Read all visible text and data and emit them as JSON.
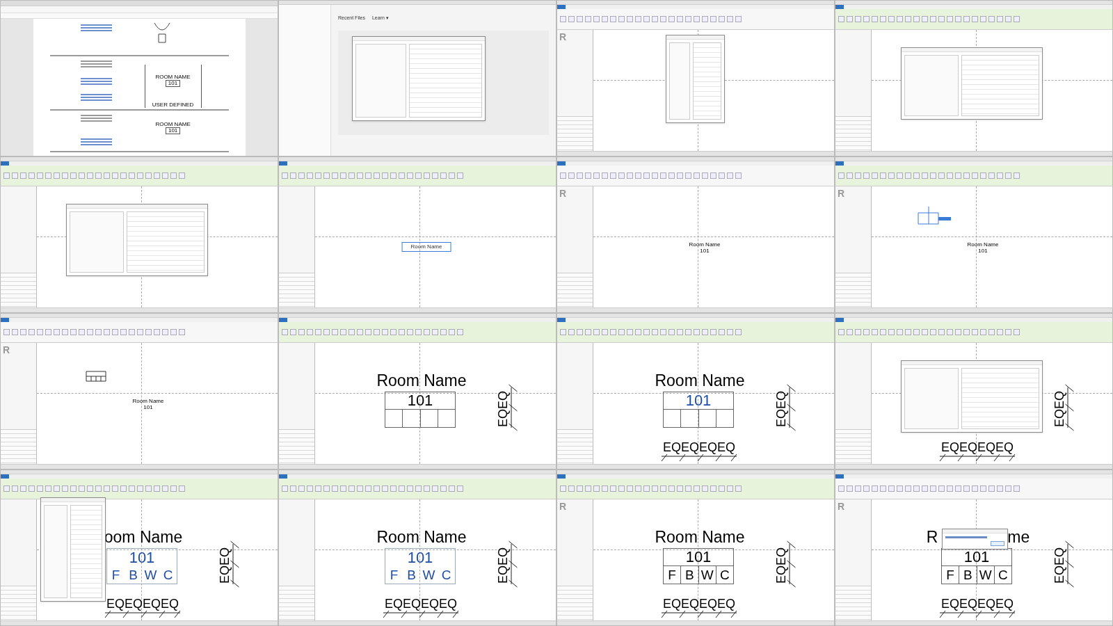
{
  "frames": [
    {
      "kind": "browser",
      "doc": {
        "drawing_1": {
          "title": "ROOM NAME",
          "number": "101",
          "width_label": "USER DEFINED"
        },
        "drawing_2": {
          "title": "ROOM NAME",
          "number": "101"
        }
      }
    },
    {
      "kind": "start",
      "heading": "Recent Files",
      "menu": "Learn ▾",
      "dialog": {
        "kind": "open-template"
      }
    },
    {
      "kind": "revit",
      "contextual": false,
      "logo": "R",
      "dialog": {
        "kind": "family-category"
      }
    },
    {
      "kind": "revit",
      "contextual": true,
      "dialog": {
        "kind": "edit-label"
      }
    },
    {
      "kind": "revit",
      "contextual": true,
      "dialog": {
        "kind": "edit-label"
      }
    },
    {
      "kind": "revit",
      "contextual": true,
      "tag": {
        "kind": "small",
        "title": "Room Name",
        "selected": true
      }
    },
    {
      "kind": "revit",
      "contextual": false,
      "logo": "R",
      "tag": {
        "kind": "small",
        "title": "Room Name",
        "number": "101",
        "selected": false
      }
    },
    {
      "kind": "revit",
      "contextual": true,
      "logo": "R",
      "sketch": {
        "kind": "grid"
      },
      "tag": {
        "kind": "small",
        "title": "Room Name",
        "number": "101",
        "selected": false
      }
    },
    {
      "kind": "revit",
      "contextual": false,
      "logo": "R",
      "sketch": {
        "kind": "table"
      },
      "tag": {
        "kind": "small",
        "title": "Room Name",
        "number": "101",
        "selected": false
      }
    },
    {
      "kind": "revit",
      "contextual": true,
      "tag": {
        "kind": "large",
        "title": "Room Name",
        "number": "101",
        "selected": false,
        "cells": true,
        "eq_vertical": "EQEQ"
      }
    },
    {
      "kind": "revit",
      "contextual": true,
      "tag": {
        "kind": "large",
        "title": "Room Name",
        "number": "101",
        "selected": true,
        "cells": true,
        "eq_vertical": "EQEQ",
        "eq_horizontal": "EQEQEQEQ"
      }
    },
    {
      "kind": "revit",
      "contextual": true,
      "dialog": {
        "kind": "edit-label"
      },
      "tag": {
        "kind": "large",
        "eq_vertical": "EQEQ",
        "eq_horizontal": "EQEQEQEQ"
      }
    },
    {
      "kind": "revit",
      "contextual": true,
      "dialog": {
        "kind": "type-properties"
      },
      "tag": {
        "kind": "large",
        "title_parts": [
          "oom Name"
        ],
        "number": "101",
        "finishes": [
          "F",
          "B",
          "W",
          "C"
        ],
        "selected": true,
        "cells": false,
        "eq_vertical": "EQEQ",
        "eq_horizontal": "EQEQEQEQ"
      }
    },
    {
      "kind": "revit",
      "contextual": true,
      "tag": {
        "kind": "large",
        "title": "Room Name",
        "number": "101",
        "finishes": [
          "F",
          "B",
          "W",
          "C"
        ],
        "selected": true,
        "cells": false,
        "eq_vertical": "EQEQ",
        "eq_horizontal": "EQEQEQEQ"
      }
    },
    {
      "kind": "revit",
      "contextual": true,
      "logo": "R",
      "tag": {
        "kind": "large",
        "title": "Room Name",
        "number": "101",
        "finishes": [
          "F",
          "B",
          "W",
          "C"
        ],
        "selected": false,
        "cells": true,
        "eq_vertical": "EQEQ",
        "eq_horizontal": "EQEQEQEQ"
      }
    },
    {
      "kind": "revit",
      "contextual": false,
      "logo": "R",
      "dialog": {
        "kind": "message"
      },
      "tag": {
        "kind": "large",
        "title_parts": [
          "R",
          "me"
        ],
        "number": "101",
        "finishes": [
          "F",
          "B",
          "W",
          "C"
        ],
        "selected": false,
        "cells": true,
        "eq_vertical": "EQEQ",
        "eq_horizontal": "EQEQEQEQ"
      }
    }
  ]
}
